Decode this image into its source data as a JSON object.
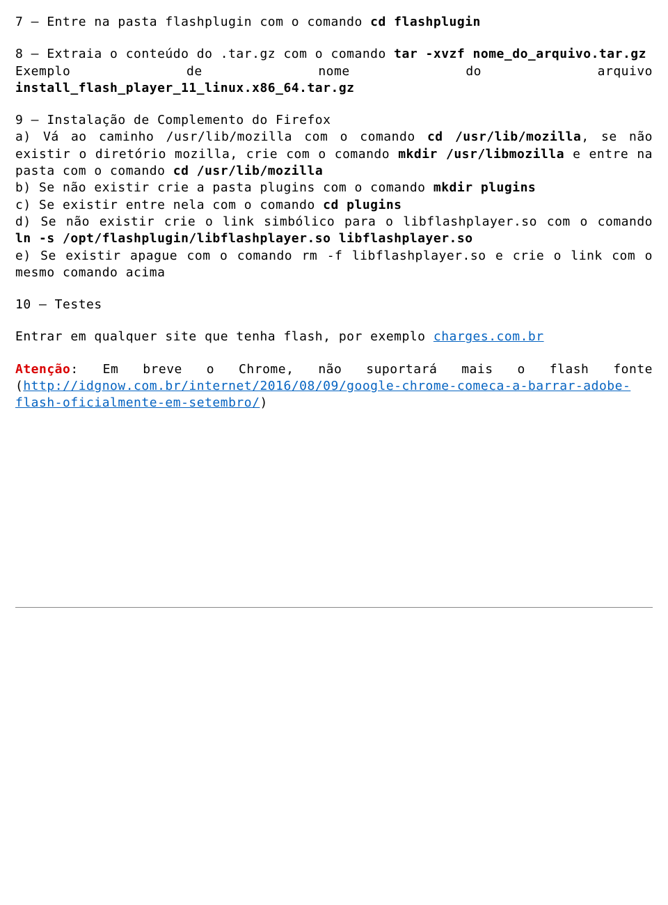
{
  "s7": {
    "prefix": "7 – Entre na pasta flashplugin com o comando ",
    "cmd": "cd flashplugin"
  },
  "s8": {
    "l1_prefix": "8 – Extraia o conteúdo do .tar.gz com o comando ",
    "l1_cmd": "tar -xvzf nome_do_arquivo.tar.gz",
    "l2_left": "Exemplo",
    "l2_mid1": "de",
    "l2_mid2": "nome",
    "l2_mid3": "do",
    "l2_right": "arquivo",
    "l3": "install_flash_player_11_linux.x86_64.tar.gz"
  },
  "s9": {
    "t": "9 – Instalação de Complemento do Firefox",
    "a1": "a) Vá ao caminho /usr/lib/mozilla com o comando ",
    "a1cmd": "cd /usr/lib/mozilla",
    "a2": ", se não existir o diretório mozilla, crie com o comando ",
    "a2cmd": "mkdir /usr/libmozilla",
    "a3": " e entre na pasta com o comando ",
    "a3cmd": "cd /usr/lib/mozilla",
    "b1": "b) Se não existir crie a pasta plugins com o comando ",
    "b1cmd": "mkdir plugins",
    "c1": "c) Se existir entre nela com o comando ",
    "c1cmd": "cd plugins",
    "d1": "d) Se não existir crie o link simbólico para o libflashplayer.so com o comando ",
    "d1cmd": "ln -s /opt/flashplugin/libflashplayer.so libflashplayer.so",
    "e1": "e) Se existir apague com o comando rm -f libflashplayer.so e crie o link com o mesmo comando acima"
  },
  "s10": {
    "t": "10 – Testes"
  },
  "tests": {
    "line": "Entrar em qualquer site que tenha flash, por exemplo ",
    "link": "charges.com.br"
  },
  "att": {
    "label": "Atenção",
    "text": ": Em breve o Chrome, não suportará mais o flash fonte (",
    "link": "http://idgnow.com.br/internet/2016/08/09/google-chrome-comeca-a-barrar-adobe-flash-oficialmente-em-setembro/",
    "close": ")"
  }
}
